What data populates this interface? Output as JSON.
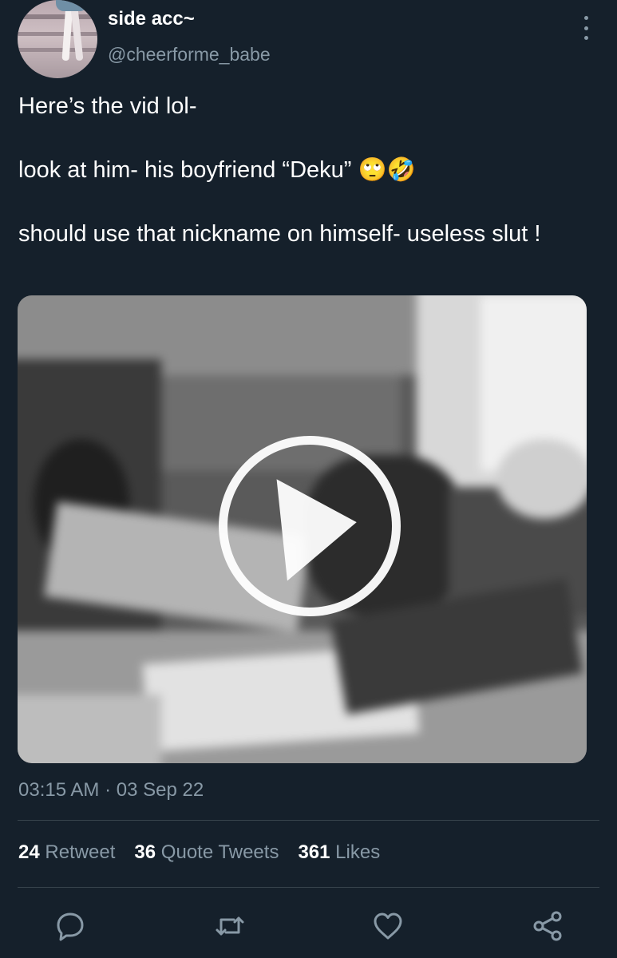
{
  "user": {
    "display_name": "side acc~",
    "handle": "@cheerforme_babe"
  },
  "tweet": {
    "lines": [
      "Here’s the vid lol-",
      "look at him- his boyfriend “Deku” 🙄🤣",
      "should use that nickname on himself- useless slut !"
    ],
    "timestamp": "03:15 AM · 03 Sep 22"
  },
  "stats": {
    "retweets": {
      "count": "24",
      "label": "Retweet"
    },
    "quotes": {
      "count": "36",
      "label": "Quote Tweets"
    },
    "likes": {
      "count": "361",
      "label": "Likes"
    }
  },
  "icons": {
    "more": "more-vertical-icon",
    "reply": "reply-icon",
    "retweet": "retweet-icon",
    "like": "heart-icon",
    "share": "share-icon",
    "play": "play-icon"
  },
  "colors": {
    "background": "#15202b",
    "secondary_text": "#8899a6",
    "divider": "#38444d"
  }
}
